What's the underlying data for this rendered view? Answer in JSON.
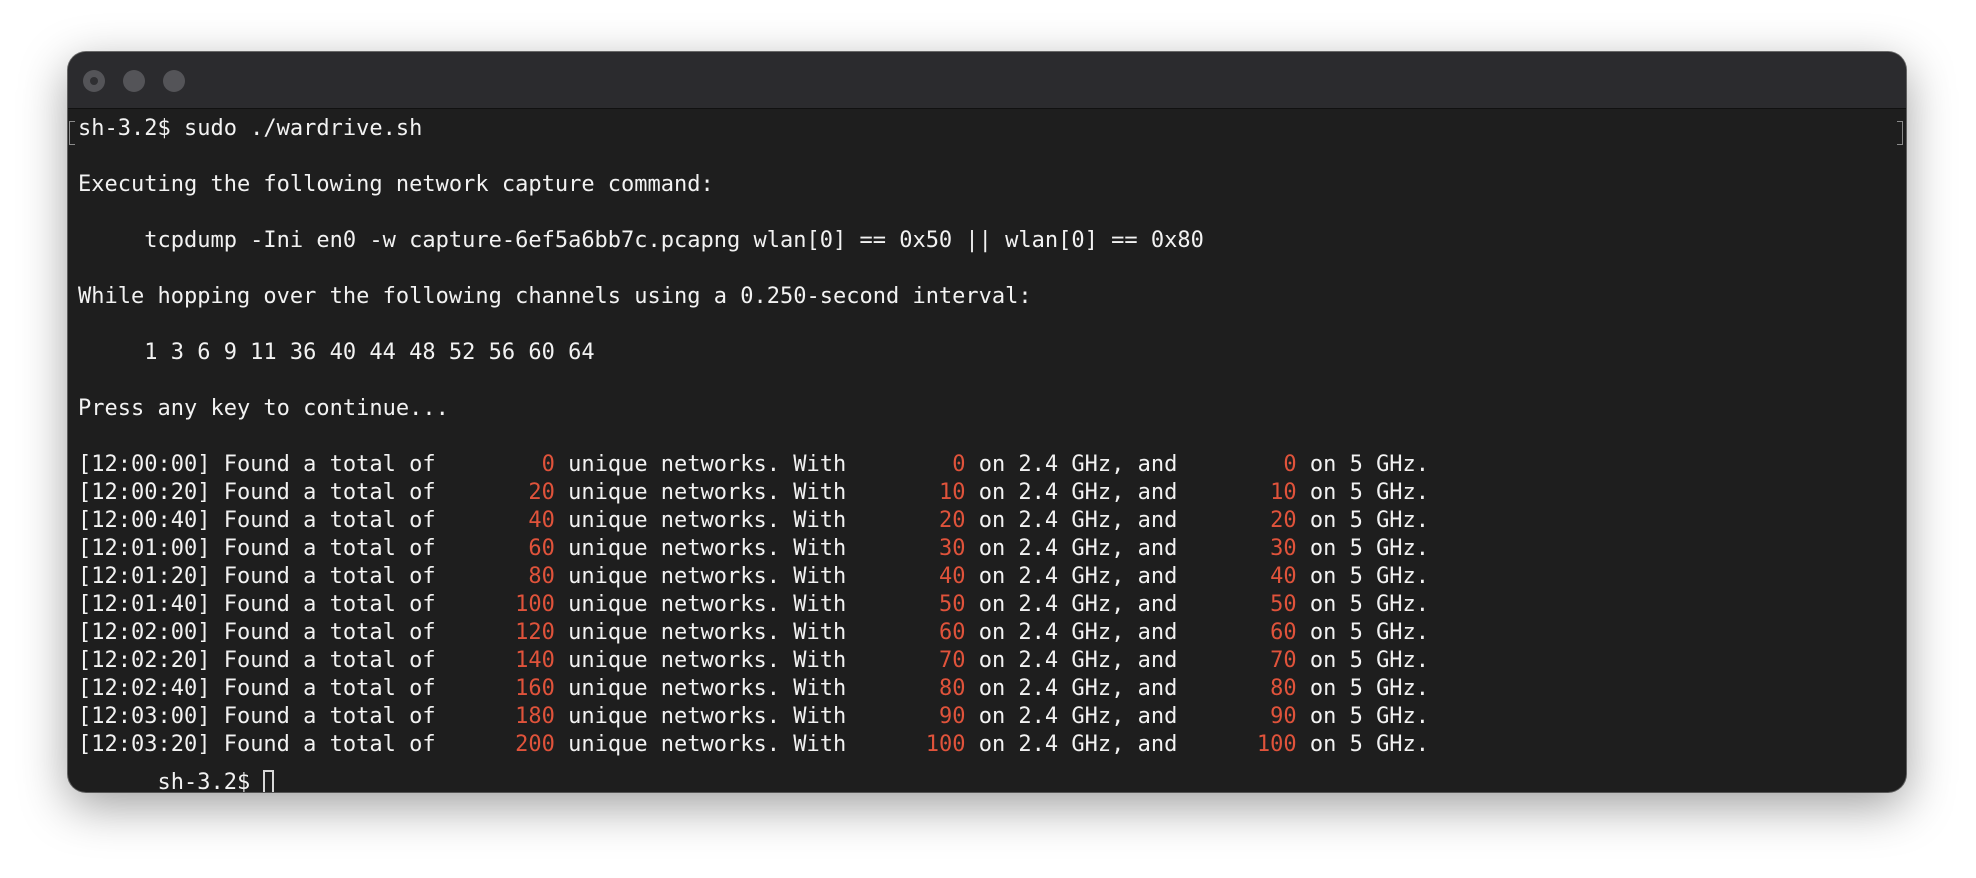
{
  "terminal": {
    "command_line": "sh-3.2$ sudo ./wardrive.sh",
    "exec_intro": "Executing the following network capture command:",
    "capture_command": "     tcpdump -Ini en0 -w capture-6ef5a6bb7c.pcapng wlan[0] == 0x50 || wlan[0] == 0x80",
    "hop_intro": "While hopping over the following channels using a 0.250-second interval:",
    "channels": "     1 3 6 9 11 36 40 44 48 52 56 60 64",
    "press_key": "Press any key to continue...",
    "log_rows": [
      {
        "time": "[12:00:00]",
        "total": "0",
        "ghz24": "0",
        "ghz5": "0"
      },
      {
        "time": "[12:00:20]",
        "total": "20",
        "ghz24": "10",
        "ghz5": "10"
      },
      {
        "time": "[12:00:40]",
        "total": "40",
        "ghz24": "20",
        "ghz5": "20"
      },
      {
        "time": "[12:01:00]",
        "total": "60",
        "ghz24": "30",
        "ghz5": "30"
      },
      {
        "time": "[12:01:20]",
        "total": "80",
        "ghz24": "40",
        "ghz5": "40"
      },
      {
        "time": "[12:01:40]",
        "total": "100",
        "ghz24": "50",
        "ghz5": "50"
      },
      {
        "time": "[12:02:00]",
        "total": "120",
        "ghz24": "60",
        "ghz5": "60"
      },
      {
        "time": "[12:02:20]",
        "total": "140",
        "ghz24": "70",
        "ghz5": "70"
      },
      {
        "time": "[12:02:40]",
        "total": "160",
        "ghz24": "80",
        "ghz5": "80"
      },
      {
        "time": "[12:03:00]",
        "total": "180",
        "ghz24": "90",
        "ghz5": "90"
      },
      {
        "time": "[12:03:20]",
        "total": "200",
        "ghz24": "100",
        "ghz5": "100"
      }
    ],
    "log_text": {
      "found": " Found a total of ",
      "unique": " unique networks. With ",
      "on24": " on 2.4 GHz, and ",
      "on5": " on 5 GHz."
    },
    "final_prompt": "sh-3.2$ "
  },
  "colors": {
    "background": "#1e1e1e",
    "titlebar": "#2b2b2e",
    "text": "#f2f2f2",
    "number": "#e0533b"
  },
  "icons": {
    "window_controls": [
      "close-icon",
      "minimize-icon",
      "zoom-icon"
    ]
  }
}
